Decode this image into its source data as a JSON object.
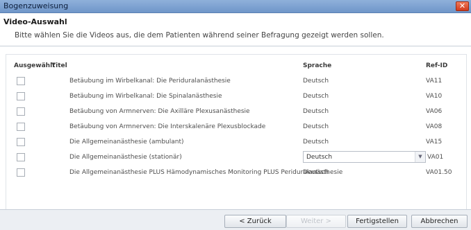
{
  "window": {
    "title": "Bogenzuweisung",
    "close_glyph": "✕"
  },
  "header": {
    "title": "Video-Auswahl",
    "description": "Bitte wählen Sie die Videos aus, die dem Patienten während seiner Befragung gezeigt werden sollen."
  },
  "table": {
    "columns": {
      "selected": "Ausgewählt",
      "title": "Titel",
      "language": "Sprache",
      "ref_id": "Ref-ID"
    },
    "rows": [
      {
        "checked": false,
        "title": "Betäubung im Wirbelkanal: Die Periduralanästhesie",
        "language": "Deutsch",
        "ref_id": "VA11"
      },
      {
        "checked": false,
        "title": "Betäubung im Wirbelkanal: Die Spinalanästhesie",
        "language": "Deutsch",
        "ref_id": "VA10"
      },
      {
        "checked": false,
        "title": "Betäubung von Armnerven: Die Axilläre Plexusanästhesie",
        "language": "Deutsch",
        "ref_id": "VA06"
      },
      {
        "checked": false,
        "title": "Betäubung von Armnerven: Die Interskalenäre Plexusblockade",
        "language": "Deutsch",
        "ref_id": "VA08"
      },
      {
        "checked": false,
        "title": "Die Allgemeinanästhesie (ambulant)",
        "language": "Deutsch",
        "ref_id": "VA15"
      },
      {
        "checked": false,
        "title": "Die Allgemeinanästhesie (stationär)",
        "language": "Deutsch",
        "ref_id": "VA01",
        "editing": true
      },
      {
        "checked": false,
        "title": "Die Allgemeinanästhesie PLUS Hämodynamisches Monitoring PLUS Periduralanästhesie",
        "language": "Deutsch",
        "ref_id": "VA01.50"
      }
    ]
  },
  "footer": {
    "back": "< Zurück",
    "next": "Weiter >",
    "finish": "Fertigstellen",
    "cancel": "Abbrechen"
  }
}
